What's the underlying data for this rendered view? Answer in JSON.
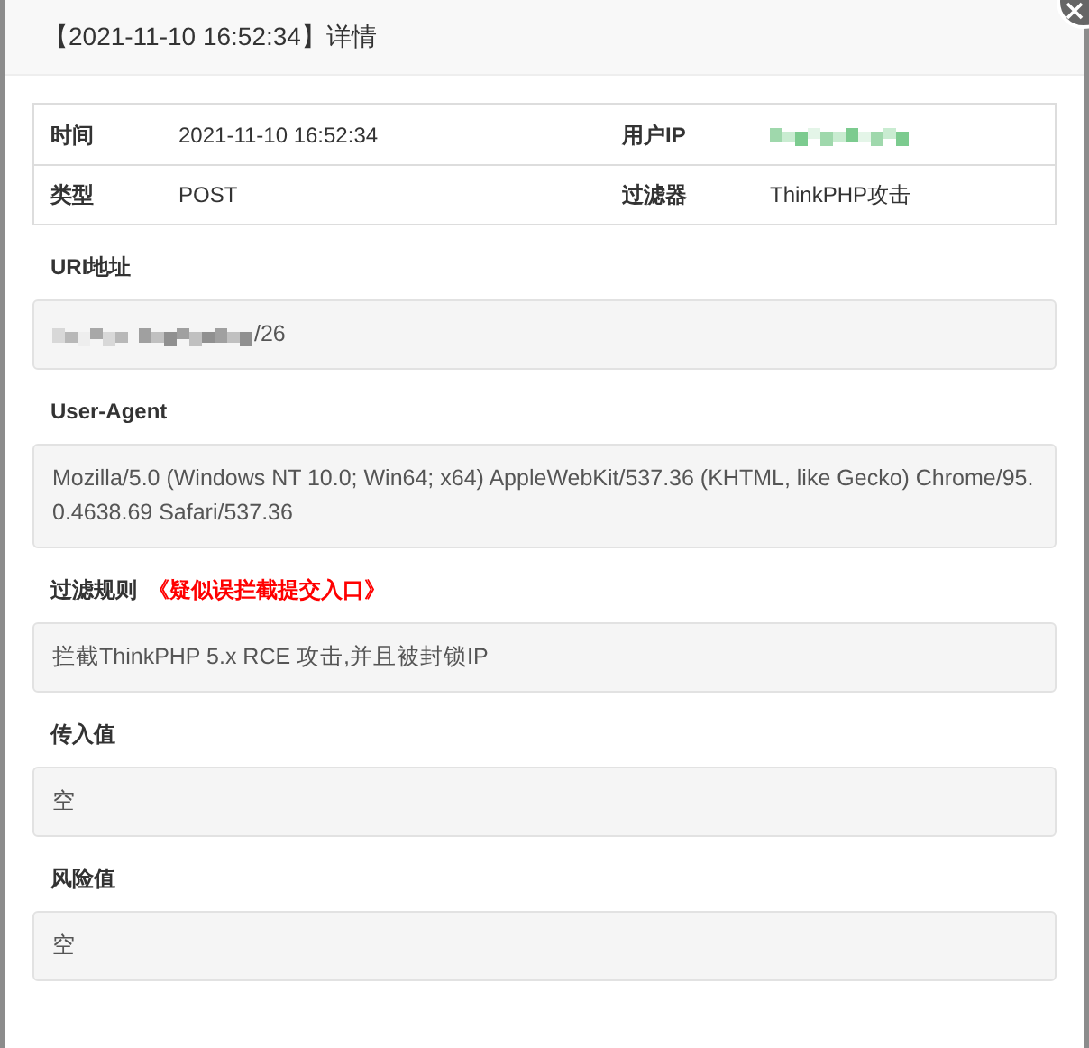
{
  "dialog": {
    "title": "【2021-11-10 16:52:34】详情"
  },
  "info_table": [
    {
      "label": "时间",
      "value": "2021-11-10 16:52:34",
      "kind": "text"
    },
    {
      "label": "用户IP",
      "kind": "redacted"
    },
    {
      "label": "类型",
      "value": "POST",
      "kind": "text"
    },
    {
      "label": "过滤器",
      "value": "ThinkPHP攻击",
      "kind": "text"
    }
  ],
  "sections": [
    {
      "label": "URI地址",
      "value": "/26",
      "kind": "redacted_prefix"
    },
    {
      "label": "User-Agent",
      "value": "Mozilla/5.0 (Windows NT 10.0; Win64; x64) AppleWebKit/537.36 (KHTML, like Gecko) Chrome/95.0.4638.69 Safari/537.36",
      "kind": "text"
    },
    {
      "label": "过滤规则",
      "rule_link": "《疑似误拦截提交入口》",
      "value": "拦截ThinkPHP 5.x RCE 攻击,并且被封锁IP",
      "kind": "text"
    },
    {
      "label": "传入值",
      "value": "空",
      "kind": "text"
    },
    {
      "label": "风险值",
      "value": "空",
      "kind": "text"
    }
  ]
}
